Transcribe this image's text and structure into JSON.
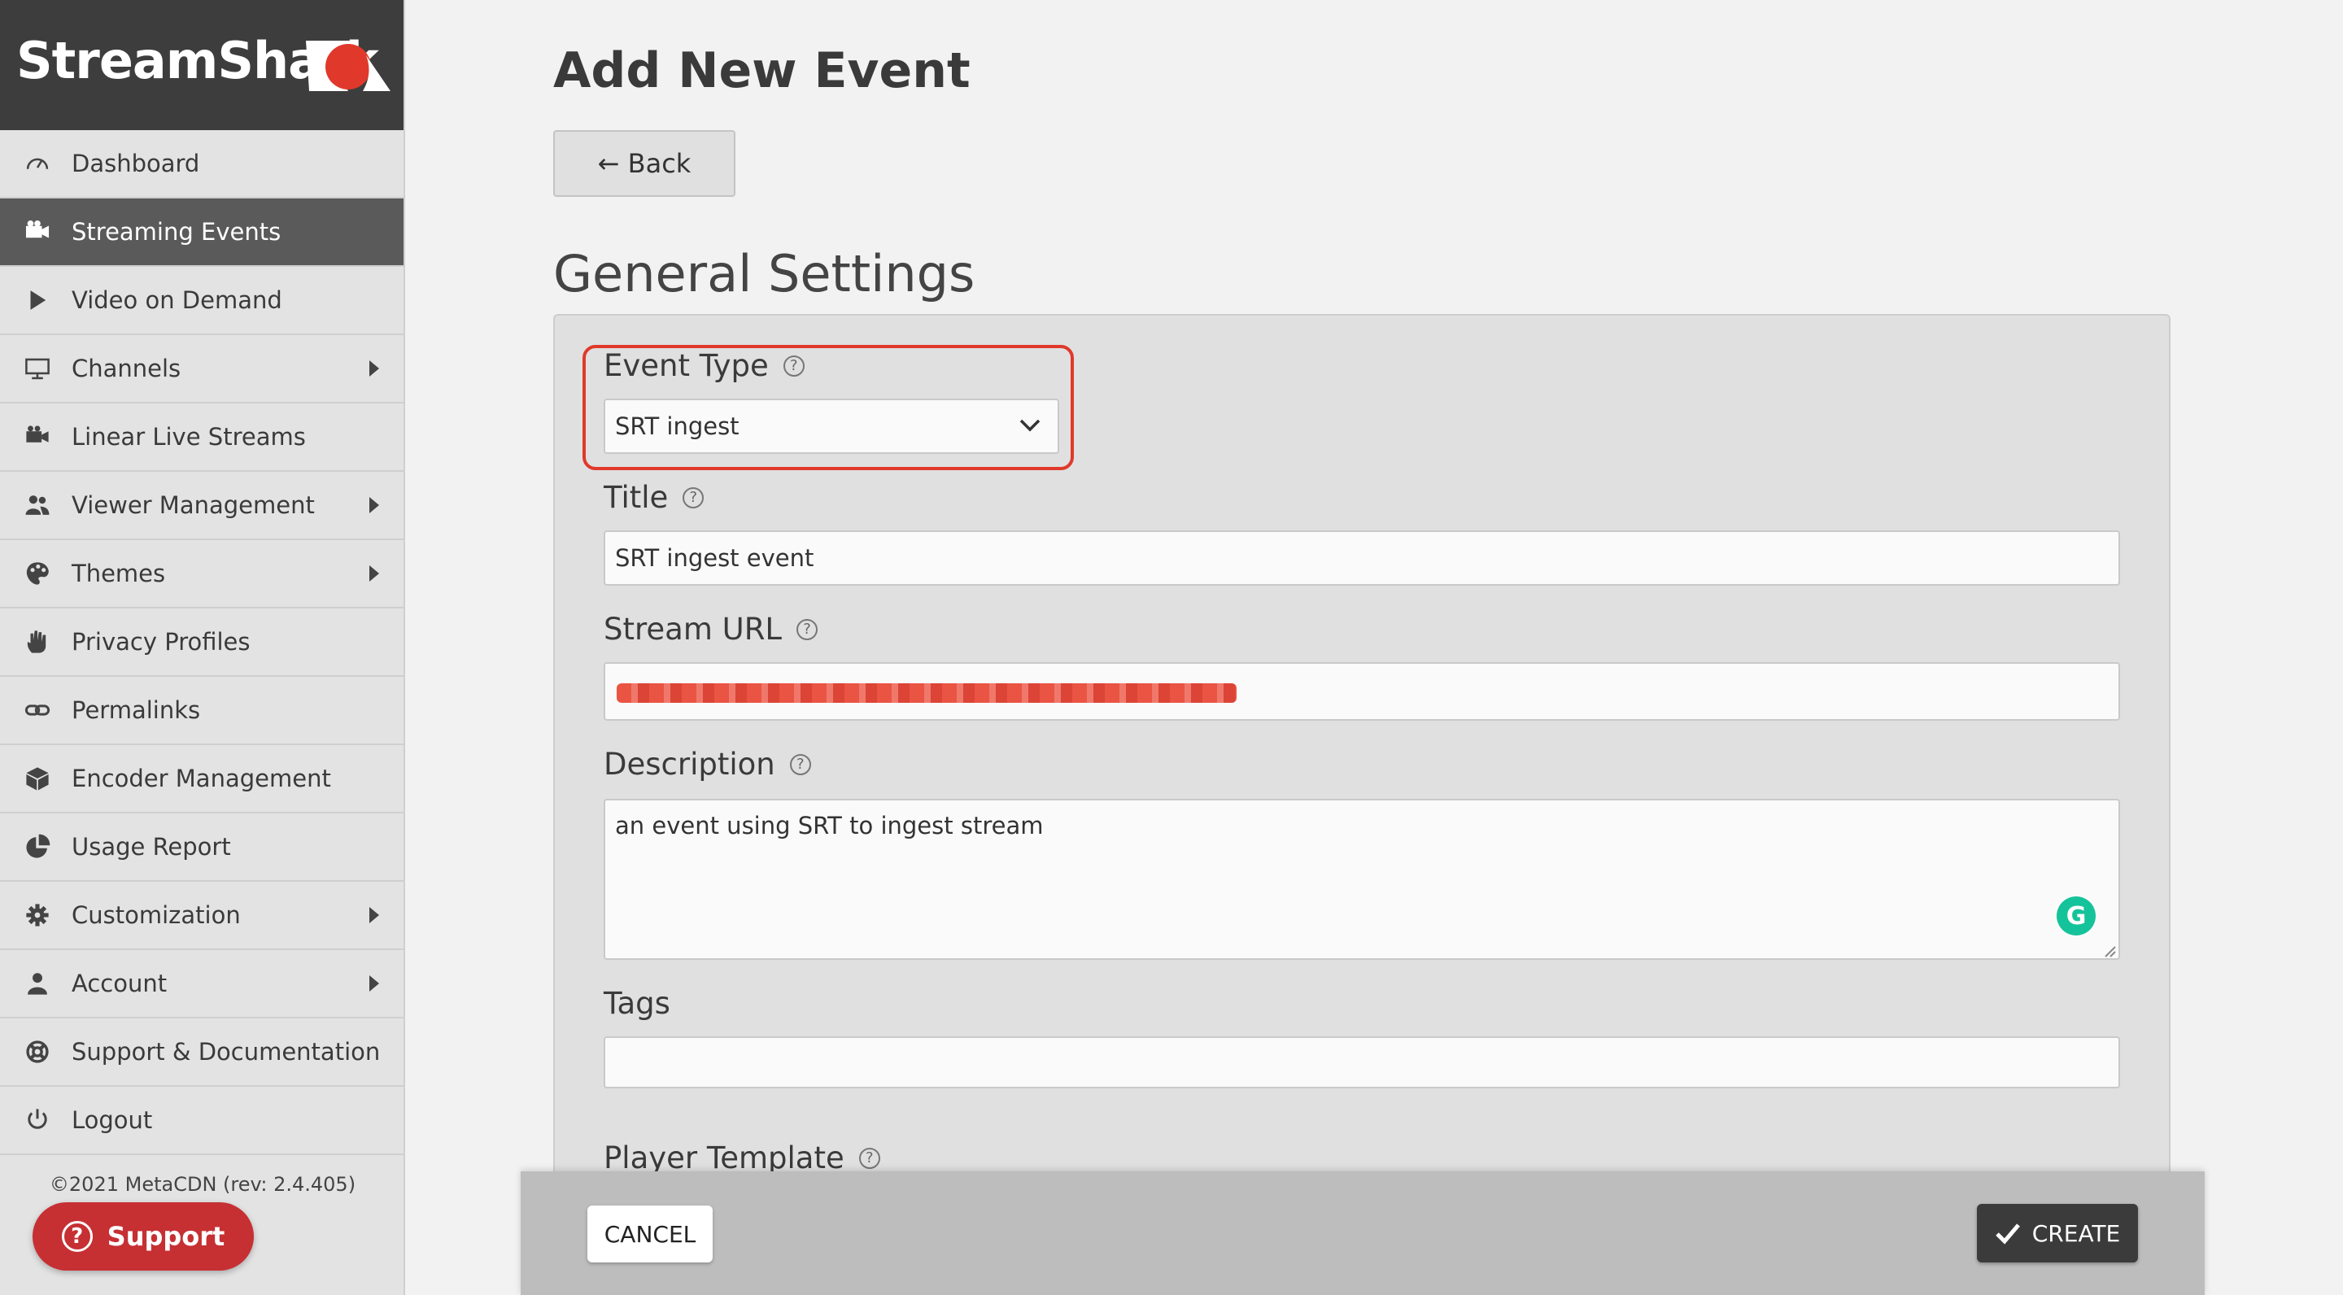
{
  "brand": {
    "name": "StreamShark",
    "logo_icon": "shark-logo-icon",
    "accent": "#e0392b"
  },
  "sidebar": {
    "items": [
      {
        "label": "Dashboard",
        "icon": "gauge-icon",
        "active": false,
        "has_submenu": false
      },
      {
        "label": "Streaming Events",
        "icon": "video-camera-icon",
        "active": true,
        "has_submenu": false
      },
      {
        "label": "Video on Demand",
        "icon": "play-icon",
        "active": false,
        "has_submenu": false
      },
      {
        "label": "Channels",
        "icon": "monitor-icon",
        "active": false,
        "has_submenu": true
      },
      {
        "label": "Linear Live Streams",
        "icon": "video-camera-icon",
        "active": false,
        "has_submenu": false
      },
      {
        "label": "Viewer Management",
        "icon": "users-icon",
        "active": false,
        "has_submenu": true
      },
      {
        "label": "Themes",
        "icon": "palette-icon",
        "active": false,
        "has_submenu": true
      },
      {
        "label": "Privacy Profiles",
        "icon": "hand-icon",
        "active": false,
        "has_submenu": false
      },
      {
        "label": "Permalinks",
        "icon": "link-icon",
        "active": false,
        "has_submenu": false
      },
      {
        "label": "Encoder Management",
        "icon": "cube-icon",
        "active": false,
        "has_submenu": false
      },
      {
        "label": "Usage Report",
        "icon": "pie-chart-icon",
        "active": false,
        "has_submenu": false
      },
      {
        "label": "Customization",
        "icon": "gear-icon",
        "active": false,
        "has_submenu": true
      },
      {
        "label": "Account",
        "icon": "user-icon",
        "active": false,
        "has_submenu": true
      },
      {
        "label": "Support & Documentation",
        "icon": "lifebuoy-icon",
        "active": false,
        "has_submenu": false
      },
      {
        "label": "Logout",
        "icon": "power-icon",
        "active": false,
        "has_submenu": false
      }
    ],
    "copyright": "©2021 MetaCDN (rev: 2.4.405)",
    "support_label": "Support"
  },
  "main": {
    "title": "Add New Event",
    "back_label": "← Back",
    "section_title": "General Settings",
    "fields": {
      "event_type": {
        "label": "Event Type",
        "value": "SRT ingest"
      },
      "title": {
        "label": "Title",
        "value": "SRT ingest event"
      },
      "stream_url": {
        "label": "Stream URL",
        "value": ""
      },
      "description": {
        "label": "Description",
        "value": "an event using SRT to ingest stream"
      },
      "tags": {
        "label": "Tags",
        "value": ""
      },
      "player_template": {
        "label": "Player Template"
      }
    }
  },
  "footer": {
    "cancel_label": "CANCEL",
    "create_label": "CREATE"
  },
  "grammarly_glyph": "G"
}
